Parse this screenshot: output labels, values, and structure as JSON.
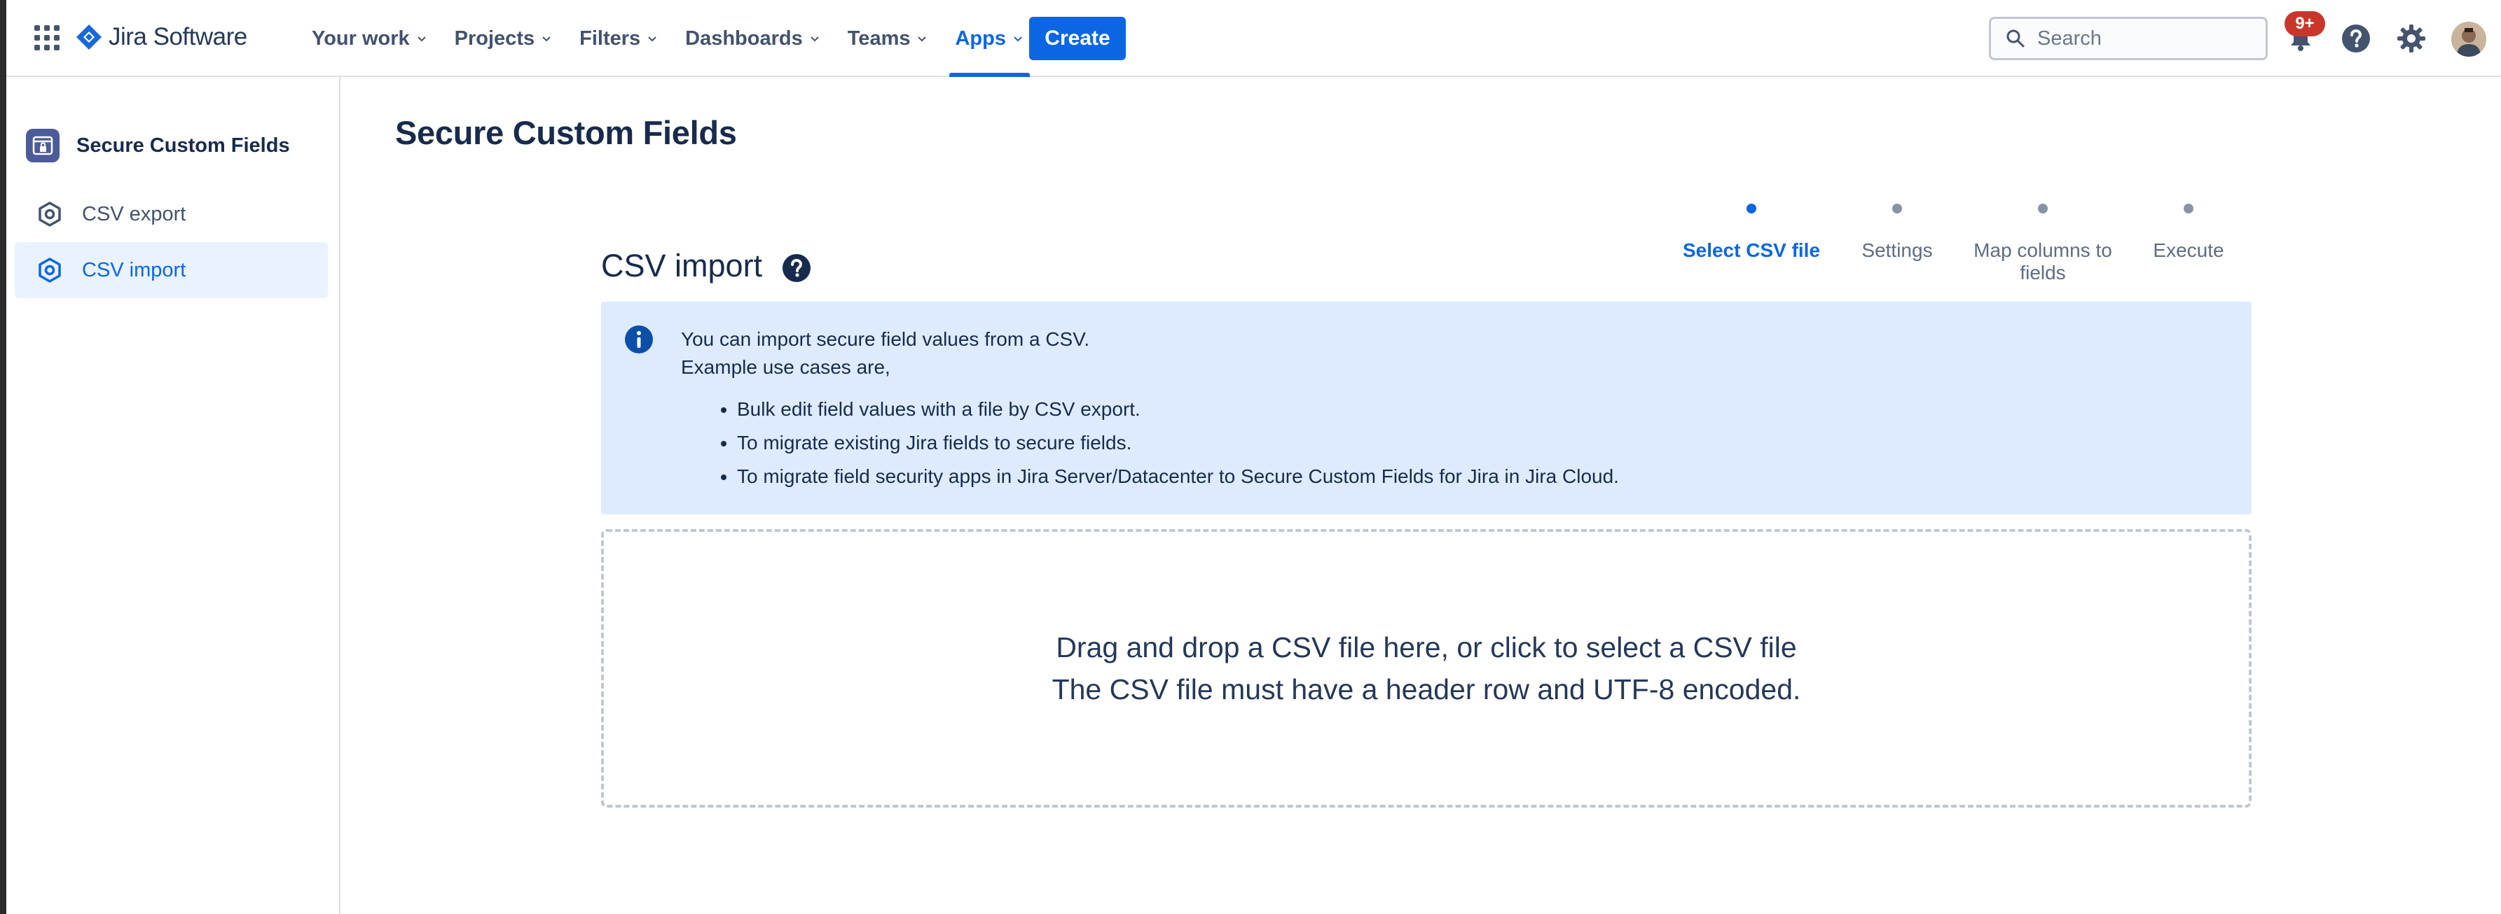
{
  "topnav": {
    "brand": "Jira Software",
    "menu": [
      {
        "label": "Your work"
      },
      {
        "label": "Projects"
      },
      {
        "label": "Filters"
      },
      {
        "label": "Dashboards"
      },
      {
        "label": "Teams"
      },
      {
        "label": "Apps"
      }
    ],
    "active_menu": "Apps",
    "create_label": "Create",
    "search_placeholder": "Search",
    "notification_count": "9+",
    "accent_color": "#0c66e4",
    "icons": [
      "app-switcher-icon",
      "jira-logo-icon",
      "search-icon",
      "bell-icon",
      "help-icon",
      "gear-icon"
    ]
  },
  "sidebar": {
    "title": "Secure Custom Fields",
    "items": [
      {
        "label": "CSV export"
      },
      {
        "label": "CSV import"
      }
    ],
    "active_item": "CSV import"
  },
  "main": {
    "page_title": "Secure Custom Fields",
    "section_title": "CSV import",
    "steps": [
      {
        "label": "Select CSV file"
      },
      {
        "label": "Settings"
      },
      {
        "label": "Map columns to fields"
      },
      {
        "label": "Execute"
      }
    ],
    "active_step": "Select CSV file",
    "info": {
      "line1": "You can import secure field values from a CSV.",
      "line2": "Example use cases are,",
      "bullets": [
        "Bulk edit field values with a file by CSV export.",
        "To migrate existing Jira fields to secure fields.",
        "To migrate field security apps in Jira Server/Datacenter to Secure Custom Fields for Jira in Jira Cloud."
      ]
    },
    "dropzone": {
      "line1": "Drag and drop a CSV file here, or click to select a CSV file",
      "line2": "The CSV file must have a header row and UTF-8 encoded."
    }
  }
}
